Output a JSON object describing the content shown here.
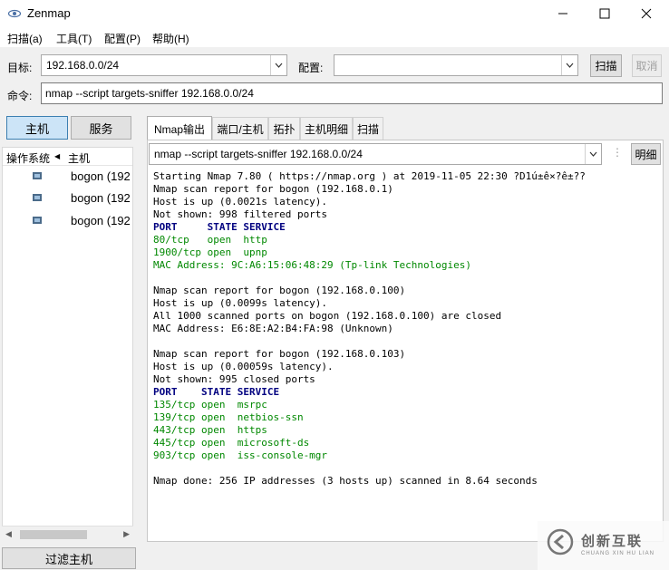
{
  "window": {
    "title": "Zenmap"
  },
  "menu": [
    "扫描(a)",
    "工具(T)",
    "配置(P)",
    "帮助(H)"
  ],
  "target": {
    "label": "目标:",
    "value": "192.168.0.0/24"
  },
  "profile": {
    "label": "配置:",
    "value": ""
  },
  "scan_button": "扫描",
  "cancel_button": "取消",
  "command": {
    "label": "命令:",
    "value": "nmap --script targets-sniffer 192.168.0.0/24"
  },
  "view_toggle": {
    "hosts": "主机",
    "services": "服务"
  },
  "host_list": {
    "col_os": "操作系统",
    "col_host": "主机",
    "hosts": [
      "bogon (192",
      "bogon (192",
      "bogon (192"
    ]
  },
  "tabs": [
    "Nmap输出",
    "端口/主机",
    "拓扑",
    "主机明细",
    "扫描"
  ],
  "output_select": "nmap --script targets-sniffer 192.168.0.0/24",
  "details_button": "明细",
  "output": {
    "l1": "Starting Nmap 7.80 ( https://nmap.org ) at 2019-11-05 22:30 ?D1ú±ê×?ê±??",
    "l2": "Nmap scan report for bogon (192.168.0.1)",
    "l3": "Host is up (0.0021s latency).",
    "l4": "Not shown: 998 filtered ports",
    "l5": "PORT     STATE SERVICE",
    "l6": "80/tcp   open  http",
    "l7": "1900/tcp open  upnp",
    "l8": "MAC Address: 9C:A6:15:06:48:29 (Tp-link Technologies)",
    "l10": "Nmap scan report for bogon (192.168.0.100)",
    "l11": "Host is up (0.0099s latency).",
    "l12": "All 1000 scanned ports on bogon (192.168.0.100) are closed",
    "l13": "MAC Address: E6:8E:A2:B4:FA:98 (Unknown)",
    "l15": "Nmap scan report for bogon (192.168.0.103)",
    "l16": "Host is up (0.00059s latency).",
    "l17": "Not shown: 995 closed ports",
    "l18": "PORT    STATE SERVICE",
    "l19": "135/tcp open  msrpc",
    "l20": "139/tcp open  netbios-ssn",
    "l21": "443/tcp open  https",
    "l22": "445/tcp open  microsoft-ds",
    "l23": "903/tcp open  iss-console-mgr",
    "l25": "Nmap done: 256 IP addresses (3 hosts up) scanned in 8.64 seconds"
  },
  "filter_button": "过滤主机",
  "watermark": {
    "text": "创新互联",
    "sub": "CHUANG XIN HU LIAN"
  },
  "colors": {
    "green": "#008800",
    "navy": "#000080",
    "accent": "#cce4f7"
  }
}
